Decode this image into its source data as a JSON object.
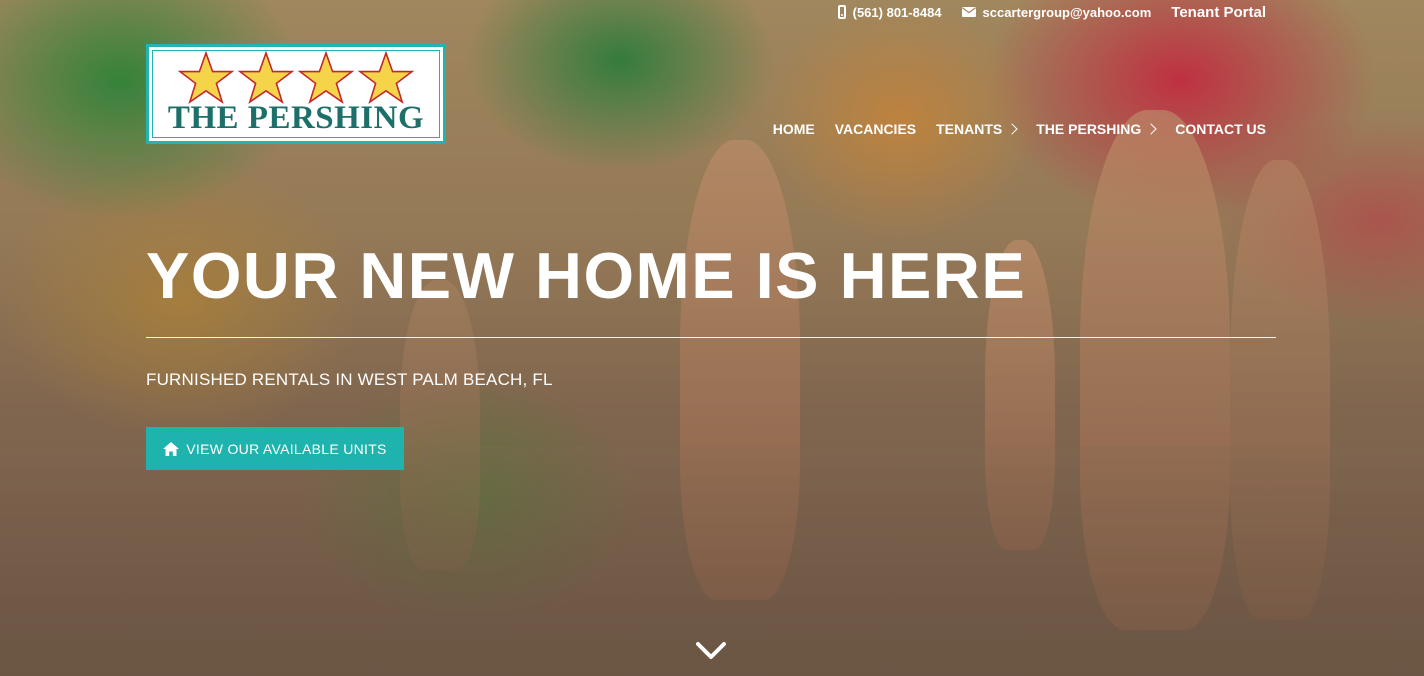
{
  "topbar": {
    "phone": "(561) 801-8484",
    "email": "sccartergroup@yahoo.com",
    "portal_label": "Tenant Portal"
  },
  "logo": {
    "text": "THE PERSHING",
    "star_count": 4
  },
  "nav": {
    "items": [
      {
        "label": "HOME",
        "has_submenu": false
      },
      {
        "label": "VACANCIES",
        "has_submenu": false
      },
      {
        "label": "TENANTS",
        "has_submenu": true
      },
      {
        "label": "THE PERSHING",
        "has_submenu": true
      },
      {
        "label": "CONTACT US",
        "has_submenu": false
      }
    ]
  },
  "hero": {
    "headline": "YOUR NEW HOME IS HERE",
    "subheadline": "FURNISHED RENTALS IN WEST PALM BEACH, FL",
    "cta_label": "VIEW OUR AVAILABLE UNITS"
  },
  "icons": {
    "phone": "phone-icon",
    "email": "mail-icon",
    "cta": "home-icon",
    "scroll": "chevron-down-icon",
    "submenu": "chevron-right-icon"
  },
  "colors": {
    "accent": "#1eb3ad",
    "logo_border": "#23b3b0",
    "logo_text": "#1d6f69",
    "star_fill": "#f5d44a",
    "star_stroke": "#c0282e",
    "text": "#ffffff"
  }
}
